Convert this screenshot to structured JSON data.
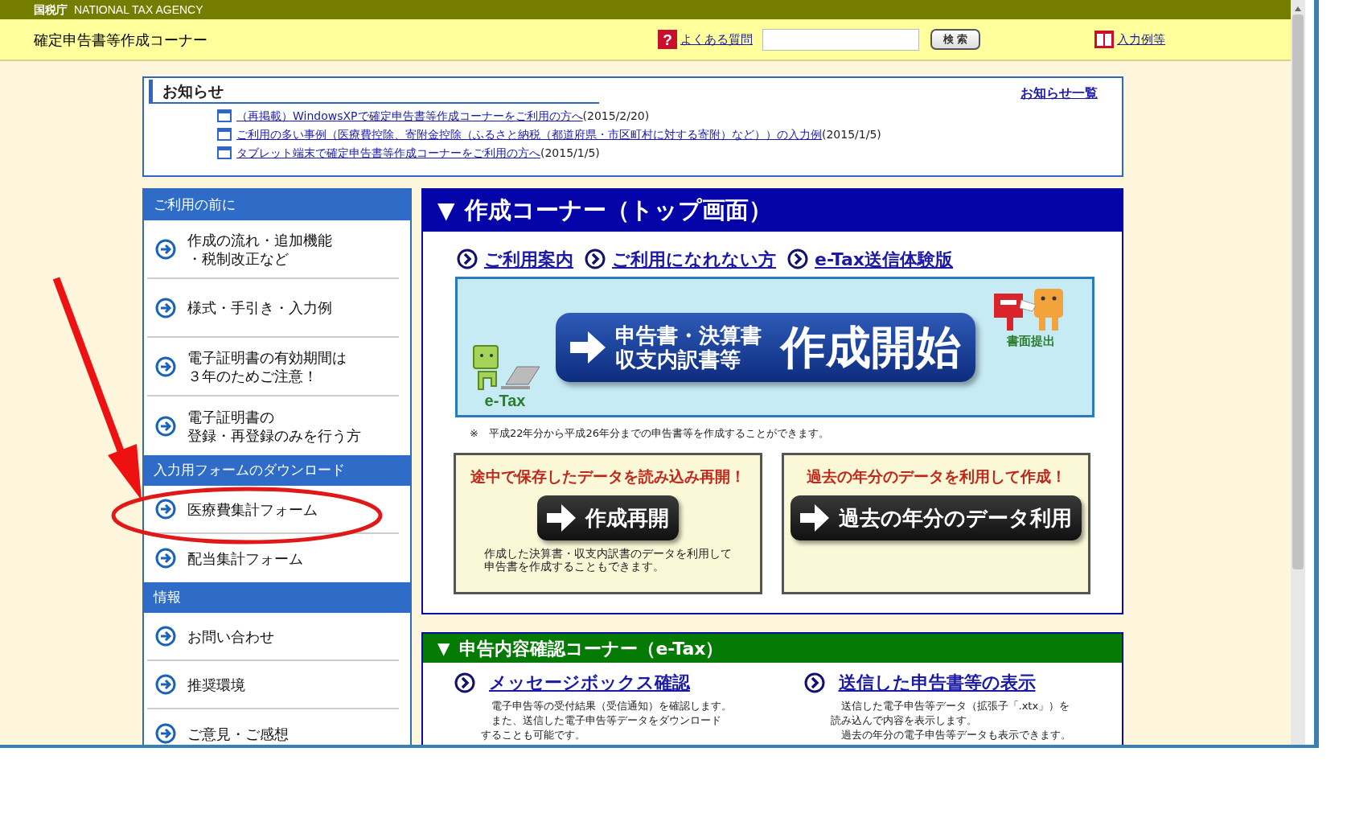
{
  "agency_bar": {
    "name_ja": "国税庁",
    "name_en": "NATIONAL TAX AGENCY"
  },
  "header": {
    "title": "確定申告書等作成コーナー",
    "help_glyph": "?",
    "faq_link": "よくある質問",
    "search_button": "検 索",
    "examples_link": "入力例等"
  },
  "notices": {
    "title": "お知らせ",
    "all_link": "お知らせ一覧",
    "items": [
      {
        "link": "（再掲載）WindowsXPで確定申告書等作成コーナーをご利用の方へ",
        "date": "(2015/2/20)"
      },
      {
        "link": "ご利用の多い事例（医療費控除、寄附金控除（ふるさと納税（都道府県・市区町村に対する寄附）など））の入力例",
        "date": "(2015/1/5)"
      },
      {
        "link": "タブレット端末で確定申告書等作成コーナーをご利用の方へ",
        "date": "(2015/1/5)"
      }
    ]
  },
  "sidebar": {
    "sections": [
      {
        "heading": "ご利用の前に",
        "items": [
          {
            "lines": [
              "作成の流れ・追加機能",
              "・税制改正など"
            ]
          },
          {
            "lines": [
              "様式・手引き・入力例"
            ]
          },
          {
            "lines": [
              "電子証明書の有効期間は",
              "３年のためご注意！"
            ]
          },
          {
            "lines": [
              "電子証明書の",
              "登録・再登録のみを行う方"
            ]
          }
        ]
      },
      {
        "heading": "入力用フォームのダウンロード",
        "items": [
          {
            "lines": [
              "医療費集計フォーム"
            ]
          },
          {
            "lines": [
              "配当集計フォーム"
            ]
          }
        ]
      },
      {
        "heading": "情報",
        "items": [
          {
            "lines": [
              "お問い合わせ"
            ]
          },
          {
            "lines": [
              "推奨環境"
            ]
          },
          {
            "lines": [
              "ご意見・ご感想"
            ]
          }
        ]
      }
    ]
  },
  "create_panel": {
    "marker": "▼",
    "title": "作成コーナー（トップ画面）",
    "links": [
      "ご利用案内",
      "ご利用になれない方",
      "e-Tax送信体験版"
    ],
    "banner": {
      "logo_text": "e-Tax",
      "lines": [
        "申告書・決算書",
        "収支内訳書等"
      ],
      "action": "作成開始",
      "paper_caption": "書面提出"
    },
    "note": "※　平成22年分から平成26年分までの申告書等を作成することができます。",
    "cards": [
      {
        "headline": "途中で保存したデータを読み込み再開！",
        "button": "作成再開",
        "note": [
          "作成した決算書・収支内訳書のデータを利用して",
          "申告書を作成することもできます。"
        ]
      },
      {
        "headline": "過去の年分のデータを利用して作成！",
        "button": "過去の年分のデータ利用"
      }
    ]
  },
  "confirm_panel": {
    "marker": "▼",
    "title": "申告内容確認コーナー（e-Tax）",
    "items": [
      {
        "link": "メッセージボックス確認",
        "text": [
          "　電子申告等の受付結果（受信通知）を確認します。",
          "　また、送信した電子申告等データをダウンロード",
          "することも可能です。"
        ]
      },
      {
        "link": "送信した申告書等の表示",
        "text": [
          "　送信した電子申告等データ（拡張子「.xtx」）を",
          "読み込んで内容を表示します。",
          "　過去の年分の電子申告等データも表示できます。"
        ]
      }
    ]
  }
}
